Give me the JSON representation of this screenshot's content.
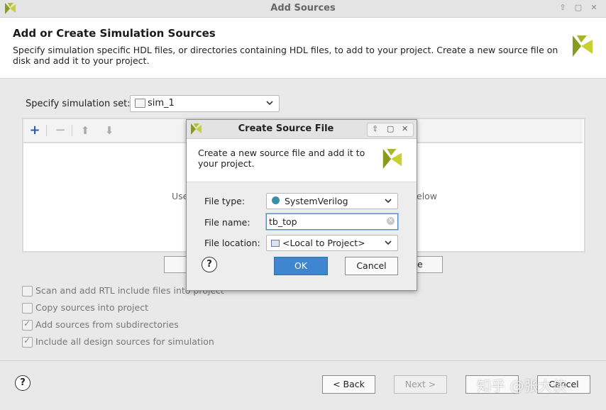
{
  "window": {
    "title": "Add Sources"
  },
  "header": {
    "title": "Add or Create Simulation Sources",
    "description": "Specify simulation specific HDL files, or directories containing HDL files, to add to your project. Create a new source file on disk and add it to your project."
  },
  "simulation_set": {
    "label": "Specify simulation set:",
    "value": "sim_1"
  },
  "sources_panel": {
    "hint_left": "Use",
    "hint_right": "elow",
    "partial_button_right": "e"
  },
  "options": [
    {
      "label": "Scan and add RTL include files into project",
      "checked": false
    },
    {
      "label": "Copy sources into project",
      "checked": false
    },
    {
      "label": "Add sources from subdirectories",
      "checked": true
    },
    {
      "label": "Include all design sources for simulation",
      "checked": true
    }
  ],
  "footer": {
    "help": "?",
    "back_label": "< Back",
    "next_label": "Next >",
    "finish_label": "",
    "cancel_label": "Cancel"
  },
  "dialog": {
    "title": "Create Source File",
    "description": "Create a new source file and add it to your project.",
    "file_type_label": "File type:",
    "file_type_value": "SystemVerilog",
    "file_name_label": "File name:",
    "file_name_value": "tb_top",
    "file_location_label": "File location:",
    "file_location_value": "<Local to Project>",
    "help": "?",
    "ok_label": "OK",
    "cancel_label": "Cancel"
  },
  "watermark": "知乎 @张大侠",
  "colors": {
    "accent": "#3f86d0",
    "logo_dark": "#8a9a1b",
    "logo_light": "#c8d132",
    "file_type_dot": "#3a8ea6"
  }
}
